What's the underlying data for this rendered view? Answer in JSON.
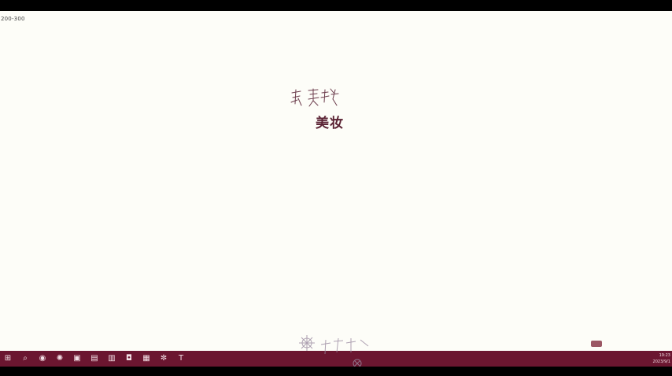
{
  "page": {
    "corner_note": "200-300",
    "heading": "美妆",
    "handwriting_text": "种美妆"
  },
  "taskbar": {
    "icons": [
      {
        "name": "windows-start-icon",
        "glyph": "⊞"
      },
      {
        "name": "search-icon",
        "glyph": "⌕"
      },
      {
        "name": "app-icon-1",
        "glyph": "◉"
      },
      {
        "name": "app-icon-2",
        "glyph": "✺"
      },
      {
        "name": "app-icon-3",
        "glyph": "▣"
      },
      {
        "name": "app-icon-4",
        "glyph": "▤"
      },
      {
        "name": "app-icon-5",
        "glyph": "▥"
      },
      {
        "name": "app-icon-6",
        "glyph": "◘"
      },
      {
        "name": "app-icon-7",
        "glyph": "▦"
      },
      {
        "name": "app-icon-8",
        "glyph": "✼"
      },
      {
        "name": "app-icon-9",
        "glyph": "T"
      }
    ],
    "tray_time": "19:23",
    "tray_date": "2023/9/1"
  },
  "colors": {
    "taskbar": "#6b1630",
    "canvas": "#fdfdf8",
    "heading": "#5a2233"
  }
}
